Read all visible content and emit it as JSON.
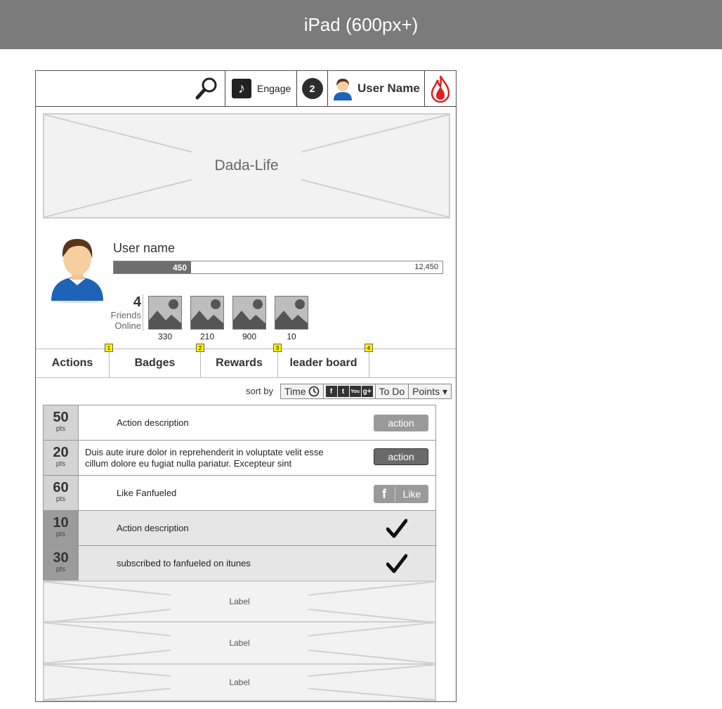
{
  "device_title": "iPad (600px+)",
  "header": {
    "engage_label": "Engage",
    "notification_count": "2",
    "user_name": "User Name"
  },
  "banner": {
    "title": "Dada-Life"
  },
  "profile": {
    "name": "User name",
    "progress": {
      "current": 450,
      "current_label": "450",
      "max_label": "12,450"
    },
    "friends_count": "4",
    "friends_label": "Friends Online",
    "thumbnails": [
      {
        "value": "330"
      },
      {
        "value": "210"
      },
      {
        "value": "900"
      },
      {
        "value": "10"
      }
    ]
  },
  "tabs": [
    {
      "label": "Actions",
      "badge": "1"
    },
    {
      "label": "Badges",
      "badge": "2"
    },
    {
      "label": "Rewards",
      "badge": "3"
    },
    {
      "label": "leader board",
      "badge": "4"
    }
  ],
  "sort": {
    "label": "sort by",
    "time_label": "Time",
    "social_icons": [
      "f",
      "t",
      "You",
      "g+"
    ],
    "todo_label": "To Do",
    "points_label": "Points ▾"
  },
  "actions": [
    {
      "points": "50",
      "unit": "pts",
      "desc": "Action description",
      "button": "action",
      "state": "pending"
    },
    {
      "points": "20",
      "unit": "pts",
      "desc": "Duis aute irure dolor in reprehenderit in voluptate velit esse cillum dolore eu fugiat nulla pariatur. Excepteur sint",
      "button": "action",
      "state": "pending"
    },
    {
      "points": "60",
      "unit": "pts",
      "desc": "Like Fanfueled",
      "button": "Like",
      "state": "like"
    },
    {
      "points": "10",
      "unit": "pts",
      "desc": "Action description",
      "state": "done"
    },
    {
      "points": "30",
      "unit": "pts",
      "desc": "subscribed to fanfueled on itunes",
      "state": "done"
    }
  ],
  "placeholders": [
    {
      "label": "Label"
    },
    {
      "label": "Label"
    },
    {
      "label": "Label"
    }
  ],
  "colors": {
    "header_bar": "#7b7b7b",
    "brand_flame": "#e02020",
    "tab_badge": "#fff200"
  }
}
